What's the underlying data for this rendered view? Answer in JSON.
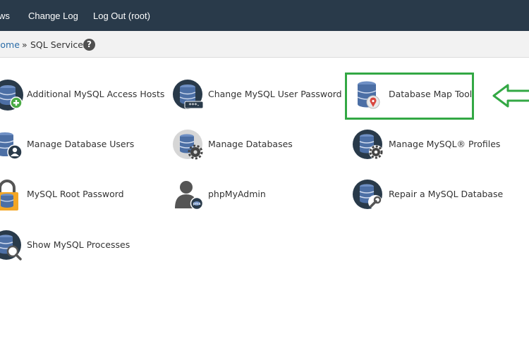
{
  "topbar": {
    "links": [
      "ws",
      "Change Log",
      "Log Out (root)"
    ]
  },
  "breadcrumb": {
    "home": "Home",
    "separator": "»",
    "current": "SQL Services",
    "help": "?"
  },
  "tools": [
    {
      "label": "Additional MySQL Access Hosts",
      "icon": "add-host-icon"
    },
    {
      "label": "Change MySQL User Password",
      "icon": "password-icon"
    },
    {
      "label": "Database Map Tool",
      "icon": "database-map-icon"
    },
    {
      "label": "Manage Database Users",
      "icon": "database-user-icon"
    },
    {
      "label": "Manage Databases",
      "icon": "manage-databases-icon"
    },
    {
      "label": "Manage MySQL® Profiles",
      "icon": "mysql-profiles-icon"
    },
    {
      "label": "MySQL Root Password",
      "icon": "root-lock-icon"
    },
    {
      "label": "phpMyAdmin",
      "icon": "phpmyadmin-icon"
    },
    {
      "label": "Repair a MySQL Database",
      "icon": "repair-database-icon"
    },
    {
      "label": "Show MySQL Processes",
      "icon": "show-processes-icon"
    }
  ],
  "colors": {
    "topbar": "#293a4a",
    "db_blue": "#4c6fa5",
    "dark_circle": "#293a4a",
    "highlight_green": "#33a844",
    "lock_yellow": "#f4a623"
  }
}
